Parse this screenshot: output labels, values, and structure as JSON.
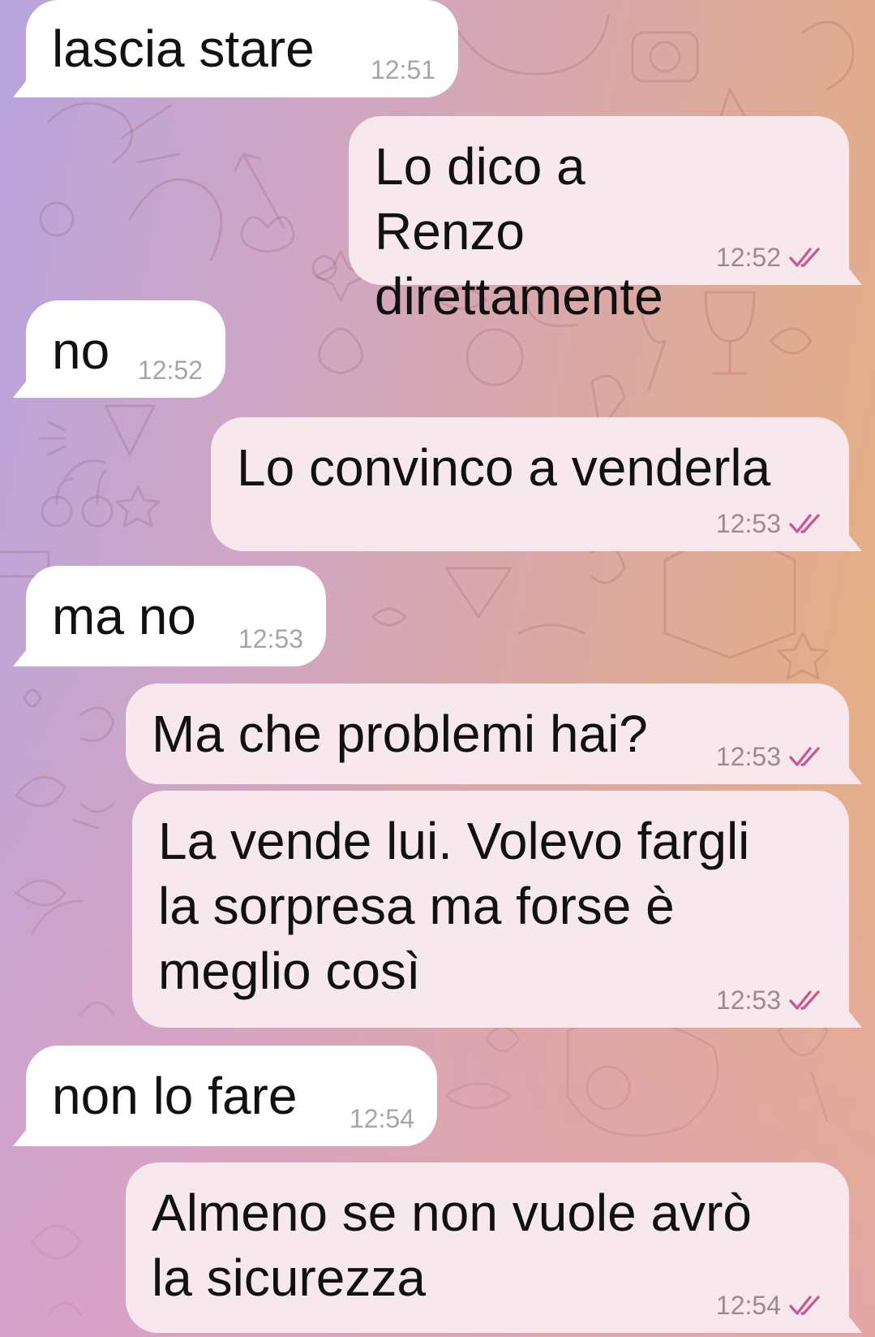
{
  "colors": {
    "incoming_bubble": "#ffffff",
    "outgoing_bubble": "#f7e8ee",
    "read_ticks": "#c75a8e",
    "timestamp": "#a0a0a0"
  },
  "messages": [
    {
      "direction": "in",
      "text": "lascia stare",
      "time": "12:51"
    },
    {
      "direction": "out",
      "text": "Lo dico a Renzo direttamente",
      "time": "12:52",
      "status_icon": "double-check-icon"
    },
    {
      "direction": "in",
      "text": "no",
      "time": "12:52"
    },
    {
      "direction": "out",
      "text": "Lo convinco a venderla",
      "time": "12:53",
      "status_icon": "double-check-icon"
    },
    {
      "direction": "in",
      "text": "ma no",
      "time": "12:53"
    },
    {
      "direction": "out",
      "text": "Ma che problemi hai?",
      "time": "12:53",
      "status_icon": "double-check-icon"
    },
    {
      "direction": "out",
      "text": "La vende lui. Volevo fargli la sorpresa ma forse è meglio così",
      "time": "12:53",
      "status_icon": "double-check-icon"
    },
    {
      "direction": "in",
      "text": "non lo fare",
      "time": "12:54"
    },
    {
      "direction": "out",
      "text": "Almeno se non vuole avrò la sicurezza",
      "time": "12:54",
      "status_icon": "double-check-icon"
    }
  ]
}
